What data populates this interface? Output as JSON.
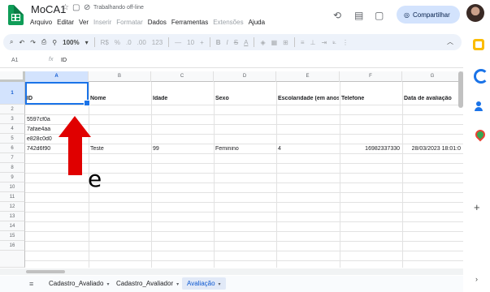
{
  "app": {
    "title": "MoCA1",
    "status": "Trabalhando off-line",
    "menus": [
      "Arquivo",
      "Editar",
      "Ver",
      "Inserir",
      "Formatar",
      "Dados",
      "Ferramentas",
      "Extensões",
      "Ajuda"
    ],
    "share_label": "Compartilhar"
  },
  "toolbar": {
    "zoom": "100%",
    "currency": "R$",
    "percent": "%",
    "dec_decrease": ".0",
    "dec_increase": ".00",
    "number_format": "123",
    "font_size_minus": "—",
    "font_size": "10",
    "font_size_plus": "+",
    "bold": "B",
    "italic": "I",
    "strike": "S",
    "text_color": "A"
  },
  "formula_bar": {
    "cell_ref": "A1",
    "fx": "fx",
    "value": "ID"
  },
  "grid": {
    "columns": [
      "A",
      "B",
      "C",
      "D",
      "E",
      "F",
      "G"
    ],
    "rows": [
      "1",
      "2",
      "3",
      "4",
      "5",
      "6",
      "7",
      "8",
      "9",
      "10",
      "11",
      "12",
      "13",
      "14",
      "15",
      "16"
    ],
    "headers": [
      "ID",
      "Nome",
      "Idade",
      "Sexo",
      "Escolaridade (em anos d",
      "Telefone",
      "Data de avaliação"
    ],
    "data": {
      "a3": "5597cf0a",
      "a4": "7afae4aa",
      "a5": "e828c0d0",
      "a6": "742d6f90",
      "b6": "Teste",
      "c6": "99",
      "d6": "Feminino",
      "e6": "4",
      "f6": "16982337330",
      "g6": "28/03/2023 18:01:0"
    }
  },
  "annotation": {
    "letter": "e",
    "color": "#e00000"
  },
  "sheets": [
    {
      "name": "Cadastro_Avaliado",
      "active": false
    },
    {
      "name": "Cadastro_Avaliador",
      "active": false
    },
    {
      "name": "Avaliação",
      "active": true
    }
  ],
  "icons": {
    "star": "☆",
    "folder": "▢",
    "offline": "⊘",
    "history": "⟲",
    "comment": "▤",
    "meet": "▢",
    "share_globe": "◎",
    "search": "⌕",
    "undo": "↶",
    "redo": "↷",
    "print": "⎙",
    "paint": "⚲",
    "collapse": "︿",
    "plus": "+",
    "expand": "›",
    "sheets_menu": "≡",
    "chevron": "▾"
  },
  "colors": {
    "accent": "#1a73e8",
    "sheet_green": "#0f9d58",
    "share_bg": "#d3e3fd",
    "arrow": "#e00000"
  }
}
